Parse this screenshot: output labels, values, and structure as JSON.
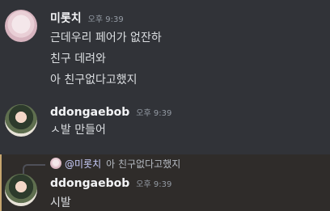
{
  "messages": [
    {
      "username": "미롯치",
      "timestamp": "오후 9:39",
      "lines": [
        "근데우리 페어가 없잔하",
        "친구 데려와",
        "아 친구없다고했지"
      ]
    },
    {
      "username": "ddongaebob",
      "timestamp": "오후 9:39",
      "lines": [
        "ㅅ발 만들어"
      ]
    },
    {
      "username": "ddongaebob",
      "timestamp": "오후 9:39",
      "lines": [
        "시발"
      ],
      "reply": {
        "mention": "@미롯치",
        "text": "아 친구없다고했지"
      }
    }
  ],
  "colors": {
    "background": "#313338",
    "reply_highlight": "#2f2c2a",
    "username": "#f2f3f5",
    "timestamp": "#949ba4",
    "mention": "#c9cdfb"
  }
}
